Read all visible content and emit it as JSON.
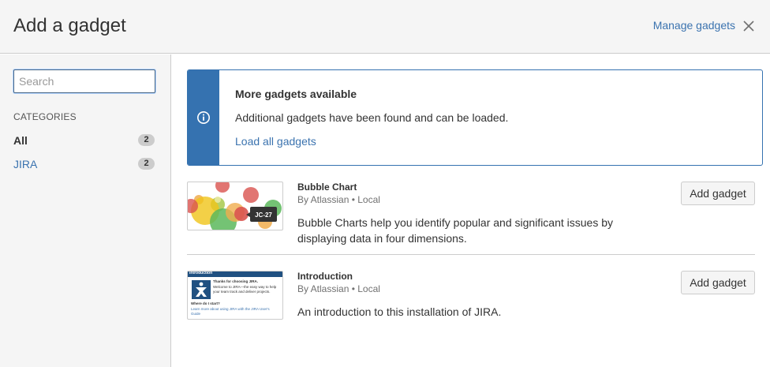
{
  "header": {
    "title": "Add a gadget",
    "manage_link": "Manage gadgets",
    "close_icon": "close-icon"
  },
  "sidebar": {
    "search_placeholder": "Search",
    "search_value": "",
    "categories_heading": "CATEGORIES",
    "categories": [
      {
        "label": "All",
        "count": "2",
        "selected": true
      },
      {
        "label": "JIRA",
        "count": "2",
        "selected": false
      }
    ]
  },
  "message": {
    "icon": "info-icon",
    "title": "More gadgets available",
    "body": "Additional gadgets have been found and can be loaded.",
    "link": "Load all gadgets",
    "accent_color": "#3572b0"
  },
  "gadgets": [
    {
      "title": "Bubble Chart",
      "meta": "By Atlassian • Local",
      "description": "Bubble Charts help you identify popular and significant issues by displaying data in four dimensions.",
      "button": "Add gadget",
      "thumbnail_tooltip": "JC-27"
    },
    {
      "title": "Introduction",
      "meta": "By Atlassian • Local",
      "description": "An introduction to this installation of JIRA.",
      "button": "Add gadget",
      "thumbnail": {
        "header": "Introduction",
        "heading": "Thanks for choosing JIRA.",
        "text": "Welcome to JIRA—the easy way to help your team track and deliver projects.",
        "subheading": "Where do I start?",
        "link_text": "Learn more about using JIRA with the JIRA User's Guide"
      }
    }
  ],
  "colors": {
    "link": "#3b73af",
    "header_bg": "#f5f5f5",
    "border": "#cccccc"
  }
}
